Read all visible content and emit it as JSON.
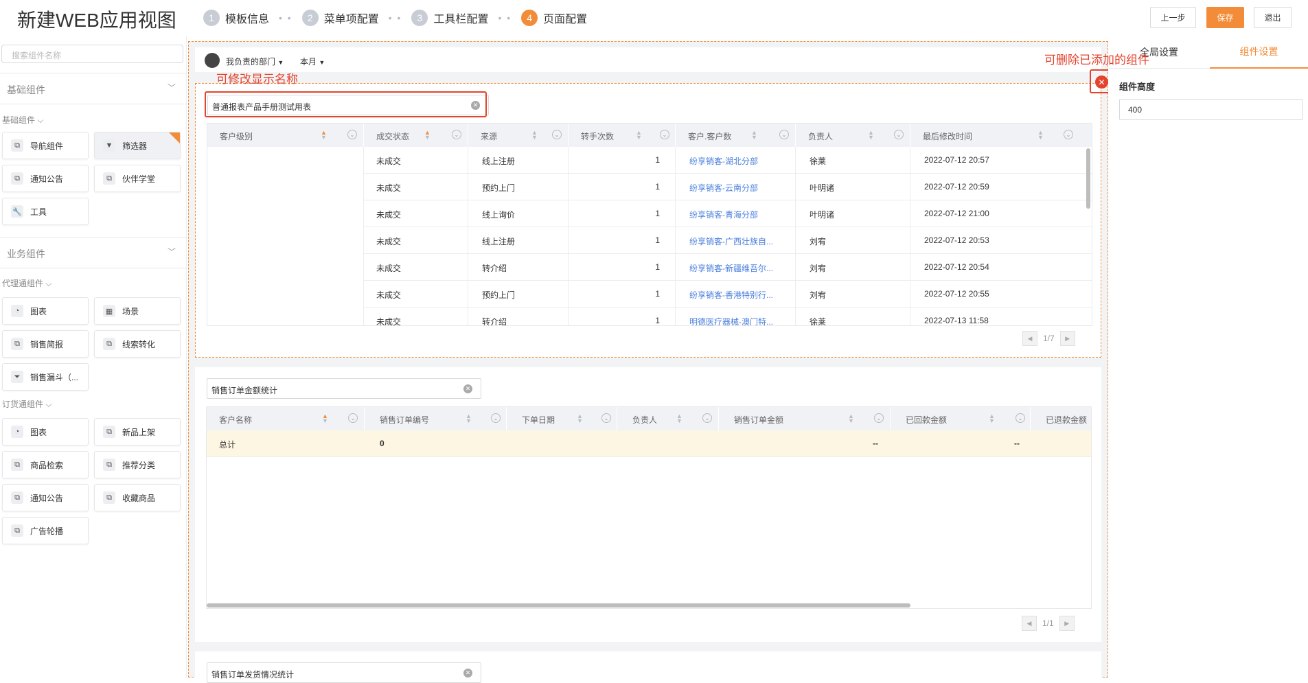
{
  "header": {
    "title": "新建WEB应用视图",
    "steps": [
      {
        "num": "1",
        "label": "模板信息"
      },
      {
        "num": "2",
        "label": "菜单项配置"
      },
      {
        "num": "3",
        "label": "工具栏配置"
      },
      {
        "num": "4",
        "label": "页面配置"
      }
    ],
    "prev_label": "上一步",
    "save_label": "保存",
    "exit_label": "退出",
    "accent_color": "#f28c38"
  },
  "sidebar": {
    "search_placeholder": "搜索组件名称",
    "group_basic": "基础组件",
    "sub_basic": "基础组件",
    "basic_items": [
      "导航组件",
      "筛选器",
      "通知公告",
      "伙伴学堂",
      "工具"
    ],
    "group_business": "业务组件",
    "sub_agent": "代理通组件",
    "agent_items": [
      "图表",
      "场景",
      "销售简报",
      "线索转化",
      "销售漏斗（..."
    ],
    "sub_order": "订货通组件",
    "order_items": [
      "图表",
      "新品上架",
      "商品检索",
      "推荐分类",
      "通知公告",
      "收藏商品",
      "广告轮播"
    ]
  },
  "filter_bar": {
    "department": "我负责的部门",
    "period": "本月"
  },
  "widget1": {
    "name": "普通报表产品手册测试用表",
    "columns": [
      "客户级别",
      "成交状态",
      "来源",
      "转手次数",
      "客户.客户数",
      "负责人",
      "最后修改时间"
    ],
    "rows": [
      {
        "status": "未成交",
        "source": "线上注册",
        "count": "1",
        "customer": "纷享销客-湖北分部",
        "owner": "徐莱",
        "time": "2022-07-12 20:57"
      },
      {
        "status": "未成交",
        "source": "预约上门",
        "count": "1",
        "customer": "纷享销客-云南分部",
        "owner": "叶明诸",
        "time": "2022-07-12 20:59"
      },
      {
        "status": "未成交",
        "source": "线上询价",
        "count": "1",
        "customer": "纷享销客-青海分部",
        "owner": "叶明诸",
        "time": "2022-07-12 21:00"
      },
      {
        "status": "未成交",
        "source": "线上注册",
        "count": "1",
        "customer": "纷享销客-广西壮族自...",
        "owner": "刘宥",
        "time": "2022-07-12 20:53"
      },
      {
        "status": "未成交",
        "source": "转介绍",
        "count": "1",
        "customer": "纷享销客-新疆维吾尔...",
        "owner": "刘宥",
        "time": "2022-07-12 20:54"
      },
      {
        "status": "未成交",
        "source": "预约上门",
        "count": "1",
        "customer": "纷享销客-香港特别行...",
        "owner": "刘宥",
        "time": "2022-07-12 20:55"
      },
      {
        "status": "未成交",
        "source": "转介绍",
        "count": "1",
        "customer": "明德医疗器械-澳门特...",
        "owner": "徐莱",
        "time": "2022-07-13 11:58"
      }
    ],
    "page": "1/7"
  },
  "widget2": {
    "name": "销售订单金额统计",
    "columns": [
      "客户名称",
      "销售订单编号",
      "下单日期",
      "负责人",
      "销售订单金额",
      "已回款金额",
      "已退款金额"
    ],
    "total_row": {
      "label": "总计",
      "order_no": "0",
      "amount": "--",
      "received": "--"
    },
    "page": "1/1"
  },
  "widget3": {
    "name": "销售订单发货情况统计"
  },
  "right_panel": {
    "tab_global": "全局设置",
    "tab_component": "组件设置",
    "height_label": "组件高度",
    "height_value": "400"
  },
  "annotations": {
    "rename": "可修改显示名称",
    "delete": "可删除已添加的组件",
    "color": "#e4432d"
  }
}
